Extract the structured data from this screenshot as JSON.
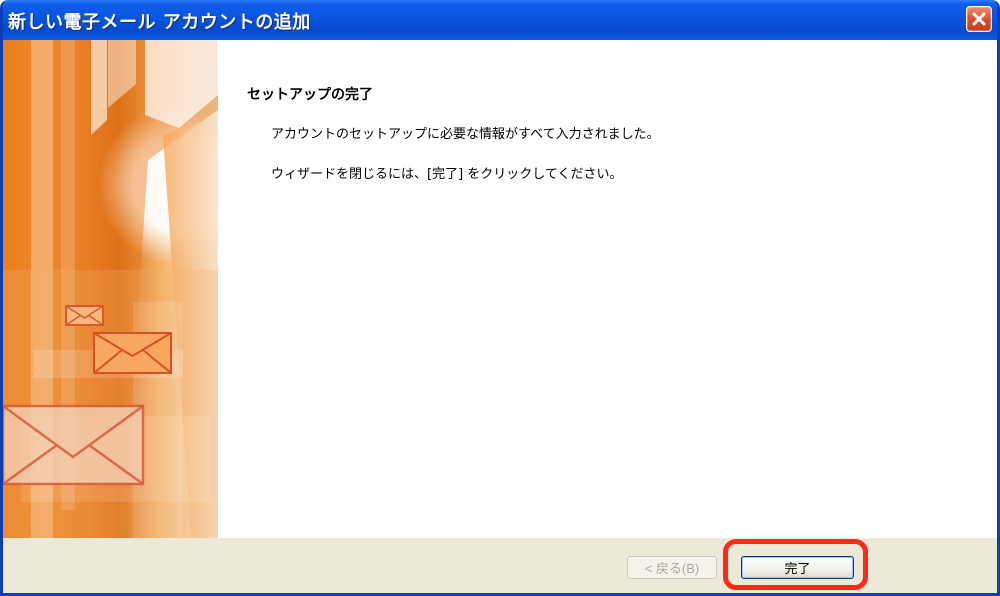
{
  "window": {
    "title": "新しい電子メール アカウントの追加"
  },
  "content": {
    "heading": "セットアップの完了",
    "message_1": "アカウントのセットアップに必要な情報がすべて入力されました。",
    "message_2": "ウィザードを閉じるには、[完了] をクリックしてください。"
  },
  "buttons": {
    "back_label": "< 戻る(B)",
    "finish_label": "完了"
  },
  "colors": {
    "title_bar": "#0a55df",
    "close_button": "#d94b2c",
    "highlight": "#ff2a1a",
    "banner_accent": "#e98224"
  },
  "icons": {
    "close": "close-icon",
    "banner_mail": "envelope-icon"
  }
}
